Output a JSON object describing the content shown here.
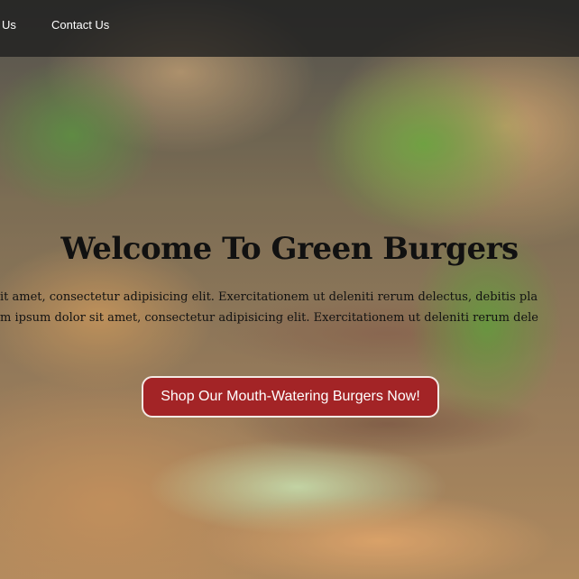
{
  "nav": {
    "items": [
      {
        "label": "Us"
      },
      {
        "label": "Contact Us"
      }
    ]
  },
  "hero": {
    "title": "Welcome To Green Burgers",
    "paragraph_line1": "it amet, consectetur adipisicing elit. Exercitationem ut deleniti rerum delectus, debitis pla",
    "paragraph_line2": "m ipsum dolor sit amet, consectetur adipisicing elit. Exercitationem ut deleniti rerum dele",
    "cta_label": "Shop Our Mouth-Watering Burgers Now!"
  },
  "colors": {
    "navbar": "#1e1e1e",
    "cta_background": "#a32426",
    "cta_border": "#f3e9e4",
    "title_text": "#111111"
  }
}
